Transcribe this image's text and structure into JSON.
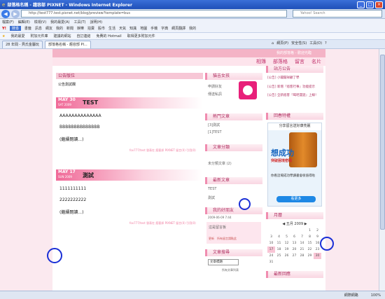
{
  "window": {
    "title": "部落格名稱 - 趨容部 PIXNET - Windows Internet Explorer"
  },
  "address": {
    "url": "http://test777.test.pixnet.net/blog/preview?template=bus",
    "search_placeholder": "Yahoo! Search"
  },
  "menu": [
    "檔案(F)",
    "編輯(E)",
    "檢視(V)",
    "我的最愛(A)",
    "工具(T)",
    "說明(H)"
  ],
  "toolbar": [
    "Y!",
    "搜尋",
    "書籤",
    "訊息",
    "網友",
    "我的",
    "新聞",
    "娛樂",
    "拍賣",
    "股市",
    "生活",
    "天氣",
    "知識",
    "地圖",
    "手機",
    "字典",
    "網頁翻譯",
    "我的"
  ],
  "favorites": [
    "我的最愛",
    "附加元件庫",
    "建議的網站",
    "自訂連結",
    "免費的 Hotmail",
    "取得更多附加元件"
  ],
  "tabs": [
    "28 年間 - 貝氏金屬玩",
    "部落格名稱 - 趨容部 PI..."
  ],
  "tab_tools": [
    "網頁(P)",
    "安全性(S)",
    "工具(O)",
    "?"
  ],
  "blog": {
    "top_text": "我的部落格 - 歡迎光臨",
    "nav": [
      "相簿",
      "部落格",
      "留言",
      "名片"
    ],
    "announcement_title": "公告版位",
    "announcement_text": "公告測試欄",
    "posts": [
      {
        "date": "MAY 30",
        "weekday": "SAT 2009",
        "title": "TEST",
        "lines": [
          "AAAAAAAAAAAAAA",
          "BBBBBBBBBBBBBB"
        ],
        "more": "(繼續閱讀...)",
        "footer": "fox777/test 發表在 痞客邦 PIXNET 留言(0) 引用(0)"
      },
      {
        "date": "MAY 17",
        "weekday": "SUN 2009",
        "title": "測試",
        "lines": [
          "1111111111",
          "2222222222"
        ],
        "more": "(繼續閱讀...)",
        "footer": "fox777/test 發表在 痞客邦 PIXNET 留言(0) 引用(0)"
      }
    ],
    "sidebar_mid": {
      "author_title": "貓吉女孩",
      "author_links": [
        "申請好友",
        "傳送私訊"
      ],
      "hot_title": "熱門文章",
      "hot_items": [
        "[3]測試",
        "[1]TEST"
      ],
      "cat_title": "文章分類",
      "cat_items": [
        "未分類文章 (2)"
      ],
      "recent_title": "最新文章",
      "recent_items": [
        "TEST",
        "測試"
      ],
      "msg_title": "我的好朋友",
      "msg_date": "2009-06-09 7:44",
      "msg_text": "這是留言板",
      "msg_links": [
        "更新",
        "所有留言請點此"
      ],
      "search_title": "文章搜尋",
      "search_select": "文章標題",
      "search_link": "所有文章列表"
    },
    "sidebar_right": {
      "news_title": "站方公告",
      "news_items": [
        "[公告] 小閣閣祥顧了學",
        "[公告] 新增『痞客行事』功能提示",
        "[公告] 全新痞客『喝吧漫遊』上線！"
      ],
      "ad_title": "回春特權",
      "ad_top": "分享留言送好康亮麗",
      "ad_main": "想成功",
      "ad_sub": "突破困境密碼",
      "ad_bottom": "你看這場成功學讀書會很值得啦",
      "ad_button": "看更多",
      "cal_title": "月曆",
      "cal_header": "五月 2009",
      "cal_rows": [
        [
          "",
          "",
          "",
          "",
          "",
          "1",
          "2"
        ],
        [
          "3",
          "4",
          "5",
          "6",
          "7",
          "8",
          "9"
        ],
        [
          "10",
          "11",
          "12",
          "13",
          "14",
          "15",
          "16"
        ],
        [
          "17",
          "18",
          "19",
          "20",
          "21",
          "22",
          "23"
        ],
        [
          "24",
          "25",
          "26",
          "27",
          "28",
          "29",
          "30"
        ],
        [
          "31",
          "",
          "",
          "",
          "",
          "",
          ""
        ]
      ],
      "last_title": "最新回應"
    }
  },
  "status": {
    "left": "",
    "zone": "網際網路",
    "zoom": "100%"
  }
}
